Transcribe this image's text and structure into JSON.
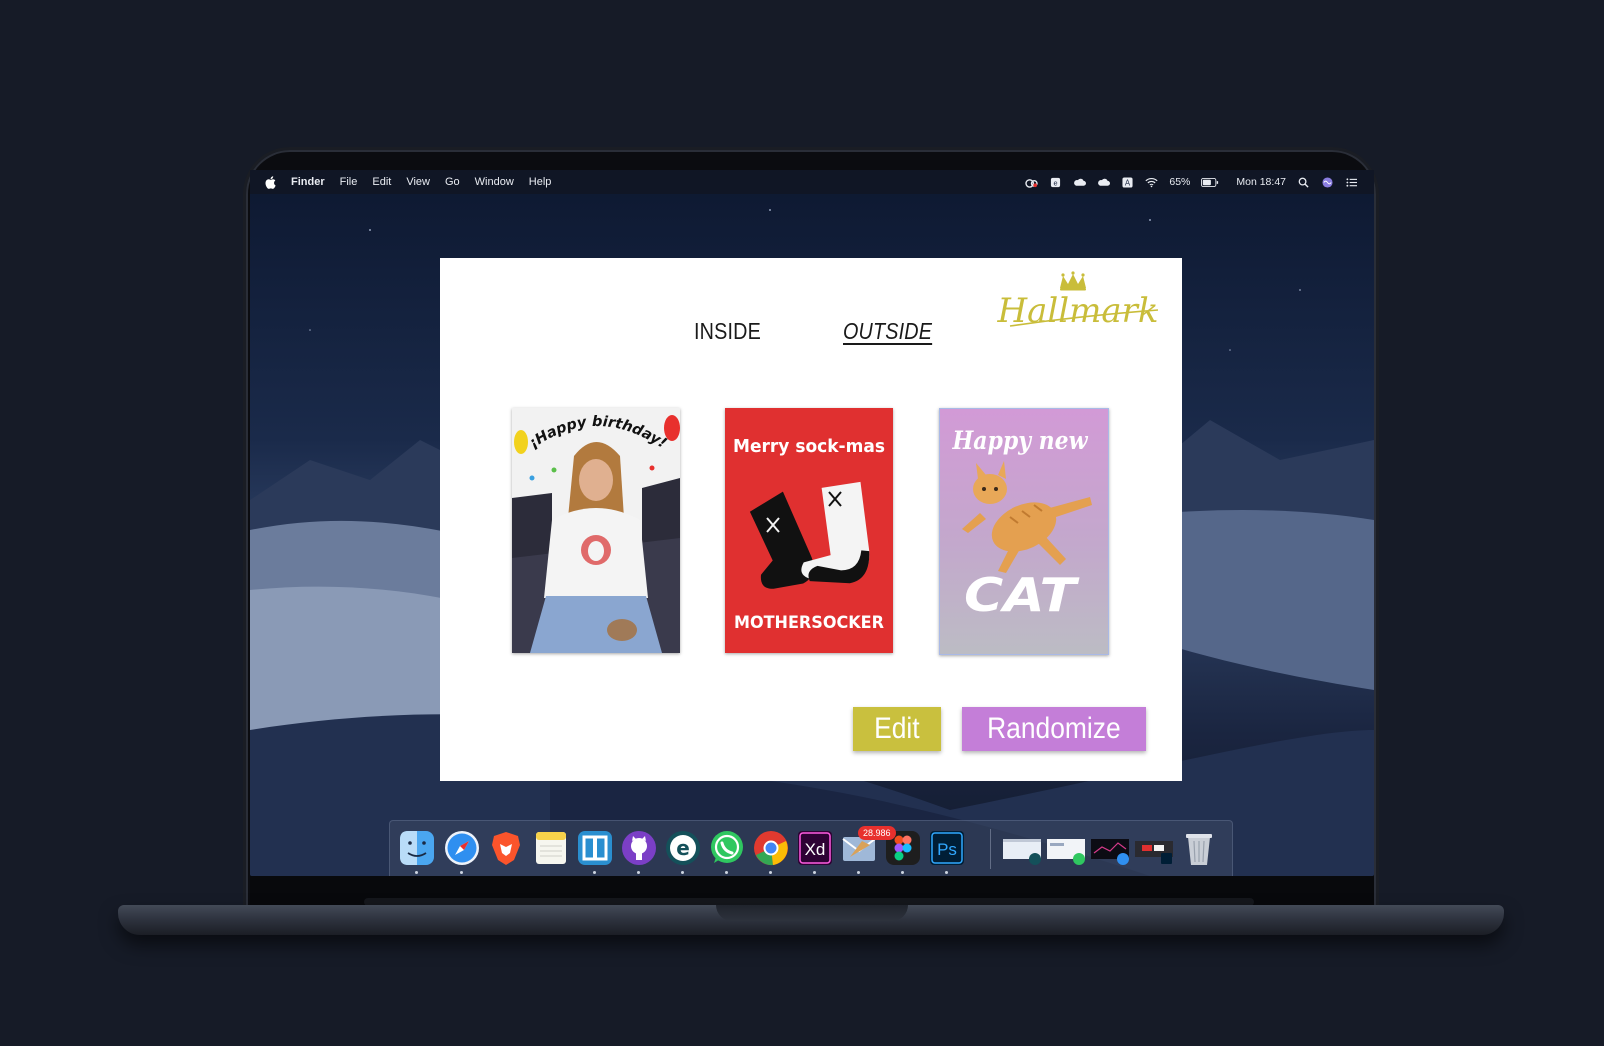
{
  "menubar": {
    "app_name": "Finder",
    "menus": [
      "File",
      "Edit",
      "View",
      "Go",
      "Window",
      "Help"
    ],
    "battery": "65%",
    "clock": "Mon 18:47"
  },
  "app": {
    "brand": "Hallmark",
    "tabs": {
      "inside": "INSIDE",
      "outside": "OUTSIDE",
      "active": "outside"
    },
    "cards": [
      {
        "headline": "¡¡Happy birthday!!",
        "footer": ""
      },
      {
        "headline": "Merry sock-mas",
        "footer": "MOTHERSOCKER"
      },
      {
        "headline": "Happy new",
        "footer": "CAT"
      }
    ],
    "buttons": {
      "edit": "Edit",
      "randomize": "Randomize"
    },
    "colors": {
      "edit": "#c9c03e",
      "randomize": "#c47ed8",
      "logo": "#c9bd3a",
      "card2_bg": "#e03030"
    }
  },
  "dock": {
    "mail_badge": "28.986",
    "apps": [
      "finder-icon",
      "safari-icon",
      "brave-icon",
      "notes-icon",
      "bracket-icon",
      "github-desktop-icon",
      "eset-icon",
      "whatsapp-icon",
      "chrome-icon",
      "adobe-xd-icon",
      "mail-icon",
      "figma-icon",
      "photoshop-icon"
    ],
    "xd_label": "Xd",
    "ps_label": "Ps"
  }
}
